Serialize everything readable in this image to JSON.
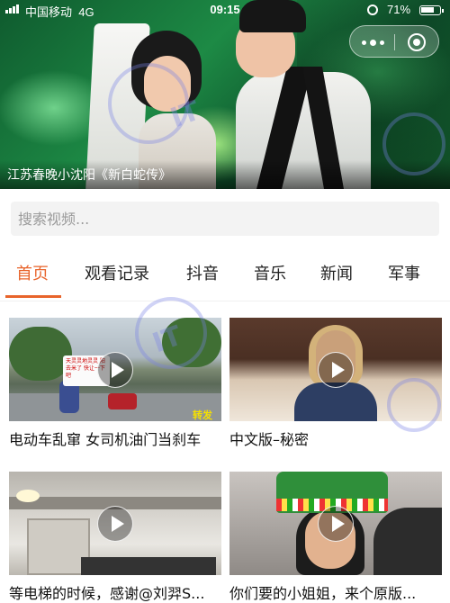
{
  "status_bar": {
    "carrier": "中国移动",
    "network": "4G",
    "time": "09:15",
    "battery": "71%"
  },
  "capsule": {
    "more_icon": "more-dots-icon",
    "close_icon": "close-target-icon"
  },
  "hero": {
    "caption": "江苏春晚小沈阳《新白蛇传》"
  },
  "search": {
    "placeholder": "搜索视频..."
  },
  "tabs": [
    {
      "label": "首页",
      "active": true
    },
    {
      "label": "观看记录",
      "active": false
    },
    {
      "label": "抖音",
      "active": false
    },
    {
      "label": "音乐",
      "active": false
    },
    {
      "label": "新闻",
      "active": false
    },
    {
      "label": "军事",
      "active": false
    }
  ],
  "colors": {
    "accent": "#e8642b",
    "search_bg": "#f3f3f3"
  },
  "videos": [
    {
      "title": "电动车乱窜 女司机油门当刹车",
      "sign_text": "天灵灵地灵灵 阳去米了 快让一下吧",
      "badge": "转发"
    },
    {
      "title": "中文版–秘密"
    },
    {
      "title": "等电梯的时候，感谢@刘羿S..."
    },
    {
      "title": "你们要的小姐姐，来个原版..."
    }
  ]
}
